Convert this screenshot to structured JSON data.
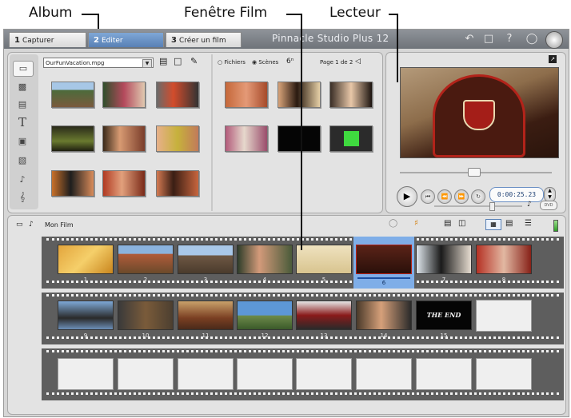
{
  "callouts": {
    "album": "Album",
    "film_window": "Fenêtre Film",
    "player": "Lecteur"
  },
  "tabs": [
    {
      "number": "1",
      "label": "Capturer"
    },
    {
      "number": "2",
      "label": "Editer"
    },
    {
      "number": "3",
      "label": "Créer un film"
    }
  ],
  "brand": "Pinnacle Studio Plus 12",
  "toolbar_icons": [
    "undo-icon",
    "redo-icon",
    "help-icon",
    "tip-icon",
    "box-icon"
  ],
  "album": {
    "file_select": "OurFunVacation.mpg",
    "radio_files": "Fichiers",
    "radio_scenes": "Scènes",
    "page": "Page 1 de 2",
    "side_icons": [
      "video-icon",
      "transition-icon",
      "photo-icon",
      "title-icon",
      "menu-icon",
      "sound-effect-icon",
      "audio-icon",
      "music-icon"
    ],
    "title_glyph": "T"
  },
  "player": {
    "timecode": "0:00:25.23",
    "dvd_label": "DVD"
  },
  "movie": {
    "title": "Mon Film",
    "frame_numbers": [
      "1",
      "2",
      "3",
      "4",
      "5",
      "6",
      "7",
      "8",
      "9",
      "10",
      "11",
      "12",
      "13",
      "14",
      "15"
    ],
    "the_end_text": "THE END"
  },
  "colors": {
    "accent": "#5880b5",
    "selected_frame": "#7faee8",
    "film_strip": "#5e5e5e"
  }
}
